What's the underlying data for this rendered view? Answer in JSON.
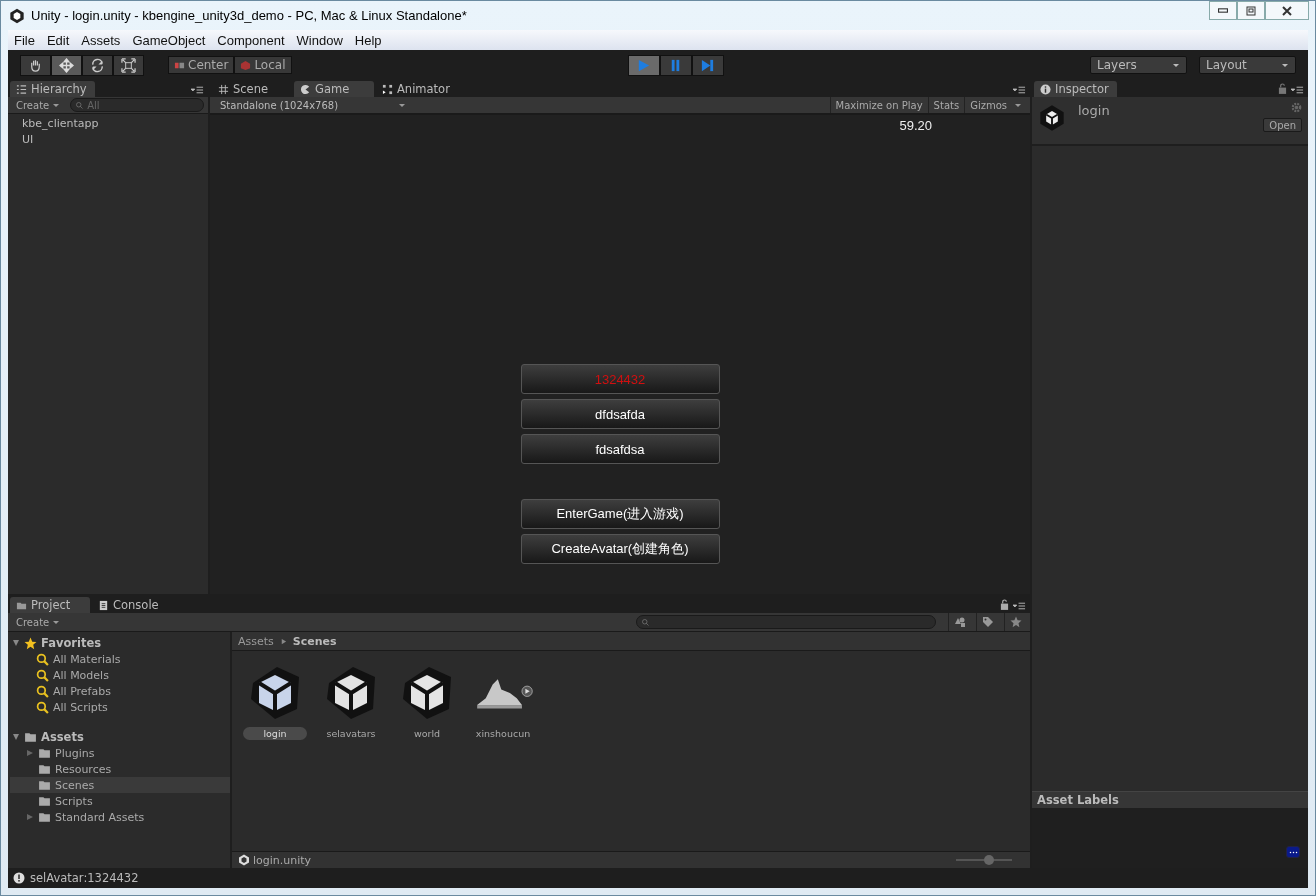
{
  "window": {
    "title": "Unity - login.unity - kbengine_unity3d_demo - PC, Mac & Linux Standalone*"
  },
  "menu": [
    "File",
    "Edit",
    "Assets",
    "GameObject",
    "Component",
    "Window",
    "Help"
  ],
  "toolbar": {
    "tools": [
      {
        "kind": "hand",
        "selected": false
      },
      {
        "kind": "move",
        "selected": true
      },
      {
        "kind": "rotate",
        "selected": false
      },
      {
        "kind": "scale",
        "selected": false
      }
    ],
    "pivot": [
      {
        "kind": "center",
        "label": "Center"
      },
      {
        "kind": "local",
        "label": "Local"
      }
    ],
    "playback": [
      {
        "kind": "play",
        "on": true
      },
      {
        "kind": "pause",
        "on": false
      },
      {
        "kind": "step",
        "on": false
      }
    ],
    "dropdowns": [
      "Layers",
      "Layout"
    ]
  },
  "hierarchy": {
    "tab": "Hierarchy",
    "create": "Create",
    "search_placeholder": "All",
    "items": [
      "kbe_clientapp",
      "UI"
    ]
  },
  "center_tabs": [
    {
      "label": "Scene",
      "kind": "scene",
      "selected": false
    },
    {
      "label": "Game",
      "kind": "game",
      "selected": true
    },
    {
      "label": "Animator",
      "kind": "animator",
      "selected": false
    }
  ],
  "game": {
    "resolution": "Standalone (1024x768)",
    "toolbar_buttons": [
      "Maximize on Play",
      "Stats",
      "Gizmos"
    ],
    "fps": "59.20",
    "avatar_buttons": [
      {
        "label": "1324432",
        "color": "#d01010"
      },
      {
        "label": "dfdsafda",
        "color": "#ffffff"
      },
      {
        "label": "fdsafdsa",
        "color": "#ffffff"
      }
    ],
    "actions": [
      "EnterGame(进入游戏)",
      "CreateAvatar(创建角色)"
    ]
  },
  "inspector": {
    "tab": "Inspector",
    "name": "login",
    "open_button": "Open",
    "asset_labels": "Asset Labels"
  },
  "bottom_tabs": [
    {
      "label": "Project",
      "kind": "project",
      "selected": true
    },
    {
      "label": "Console",
      "kind": "console",
      "selected": false
    }
  ],
  "project": {
    "create": "Create",
    "favorites": {
      "label": "Favorites",
      "expanded": true,
      "items": [
        "All Materials",
        "All Models",
        "All Prefabs",
        "All Scripts"
      ]
    },
    "assets": {
      "label": "Assets",
      "expanded": true,
      "children": [
        {
          "label": "Plugins",
          "expandable": true,
          "selected": false
        },
        {
          "label": "Resources",
          "expandable": false,
          "selected": false
        },
        {
          "label": "Scenes",
          "expandable": false,
          "selected": true
        },
        {
          "label": "Scripts",
          "expandable": false,
          "selected": false
        },
        {
          "label": "Standard Assets",
          "expandable": true,
          "selected": false
        }
      ]
    },
    "breadcrumb": [
      "Assets",
      "Scenes"
    ],
    "items": [
      {
        "name": "login",
        "kind": "scene",
        "selected": true
      },
      {
        "name": "selavatars",
        "kind": "scene",
        "selected": false
      },
      {
        "name": "world",
        "kind": "scene",
        "selected": false
      },
      {
        "name": "xinshoucun",
        "kind": "terrain",
        "selected": false
      }
    ],
    "footer_path": "login.unity",
    "icon_size": {
      "level": 0.6
    }
  },
  "status_bar": {
    "message": "selAvatar:1324432"
  }
}
